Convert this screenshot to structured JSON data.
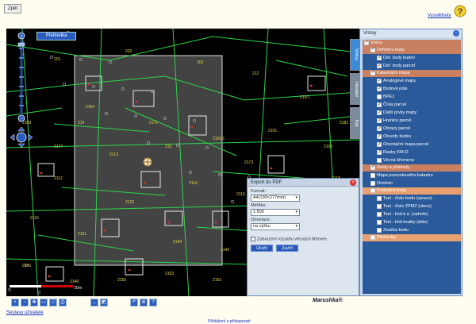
{
  "header": {
    "back_label": "Zpět",
    "help_label": "Vysvětlivky"
  },
  "map": {
    "overview_label": "Přehledka",
    "scale_text": "20m",
    "parcel_labels": [
      "201",
      "202",
      "203",
      "212",
      "213/1",
      "214",
      "215",
      "2100/1",
      "2101",
      "2108",
      "2109",
      "2112",
      "2113",
      "2114",
      "2116",
      "2117",
      "2118",
      "2119",
      "2131",
      "2132",
      "2140",
      "2142",
      "2143",
      "2144",
      "2145",
      "2146",
      "2150",
      "2152",
      "2153",
      "2159",
      "2161",
      "2162",
      "2164",
      "2171",
      "2173",
      "2177",
      "2181"
    ],
    "tools": [
      "zoom-in",
      "zoom-out",
      "pan",
      "select",
      "info",
      "print",
      "measure",
      "measure-area",
      "undo",
      "layers",
      "help"
    ]
  },
  "export_dialog": {
    "title": "Export do PDF",
    "format_label": "Formát:",
    "format_value": "A4(190×277mm)",
    "scale_label": "Měřítko:",
    "scale_value": "1:500",
    "orientation_label": "Orientace:",
    "orientation_value": "na výšku",
    "checkbox_label": "Zobrazení rozsahu věcných břemen",
    "save_button": "Uložit",
    "close_button": "Zavřít"
  },
  "layers": {
    "title": "Vrstvy",
    "tabs": [
      "Vrstvy",
      "Hledání",
      "Tisk"
    ],
    "items": [
      {
        "label": "Vrstvy",
        "type": "group",
        "checked": true,
        "level": 0
      },
      {
        "label": "Definiční body",
        "type": "group",
        "checked": true,
        "level": 1
      },
      {
        "label": "Def. body budov",
        "type": "item",
        "checked": true,
        "level": 2
      },
      {
        "label": "Def. body parcel",
        "type": "item",
        "checked": true,
        "level": 2
      },
      {
        "label": "Katastrální mapa",
        "type": "group",
        "checked": true,
        "level": 1
      },
      {
        "label": "Analogové mapy",
        "type": "item",
        "checked": true,
        "level": 2
      },
      {
        "label": "Bodové pole",
        "type": "item",
        "checked": true,
        "level": 2
      },
      {
        "label": "BPEJ",
        "type": "item",
        "checked": false,
        "level": 2
      },
      {
        "label": "Čísla parcel",
        "type": "item",
        "checked": true,
        "level": 2
      },
      {
        "label": "Další prvky mapy",
        "type": "item",
        "checked": true,
        "level": 2
      },
      {
        "label": "Hranice parcel",
        "type": "item",
        "checked": true,
        "level": 2
      },
      {
        "label": "Obrazy parcel",
        "type": "item",
        "checked": true,
        "level": 2
      },
      {
        "label": "Obvody budov",
        "type": "item",
        "checked": true,
        "level": 2
      },
      {
        "label": "Orientační mapa parcel",
        "type": "item",
        "checked": true,
        "level": 2
      },
      {
        "label": "Rastry KM-D",
        "type": "item",
        "checked": true,
        "level": 2
      },
      {
        "label": "Věcná břemena",
        "type": "item",
        "checked": false,
        "level": 2
      },
      {
        "label": "Rasty a přehledy",
        "type": "group",
        "checked": true,
        "level": 1
      },
      {
        "label": "Mapa pozemkového katastru",
        "type": "item",
        "checked": false,
        "level": 1
      },
      {
        "label": "Ortofoto",
        "type": "item",
        "checked": false,
        "level": 1
      },
      {
        "label": "Podrobné body",
        "type": "group",
        "checked": false,
        "level": 1
      },
      {
        "label": "Text - číslo bodu (vpravo)",
        "type": "item",
        "checked": false,
        "level": 2
      },
      {
        "label": "Text - číslo ZPMZ (vlevo)",
        "type": "item",
        "checked": false,
        "level": 2
      },
      {
        "label": "Text - kód k.ú. (nahoře)",
        "type": "item",
        "checked": false,
        "level": 2
      },
      {
        "label": "Text - kód kvality (dole)",
        "type": "item",
        "checked": false,
        "level": 2
      },
      {
        "label": "Značka bodu",
        "type": "item",
        "checked": false,
        "level": 2
      },
      {
        "label": "Přehledky",
        "type": "group",
        "checked": false,
        "level": 1
      }
    ]
  },
  "footer": {
    "brand": "Marushka®",
    "assistant_link": "Sestavy uživatele",
    "login_link": "Přihlášení o přístupnosti"
  }
}
